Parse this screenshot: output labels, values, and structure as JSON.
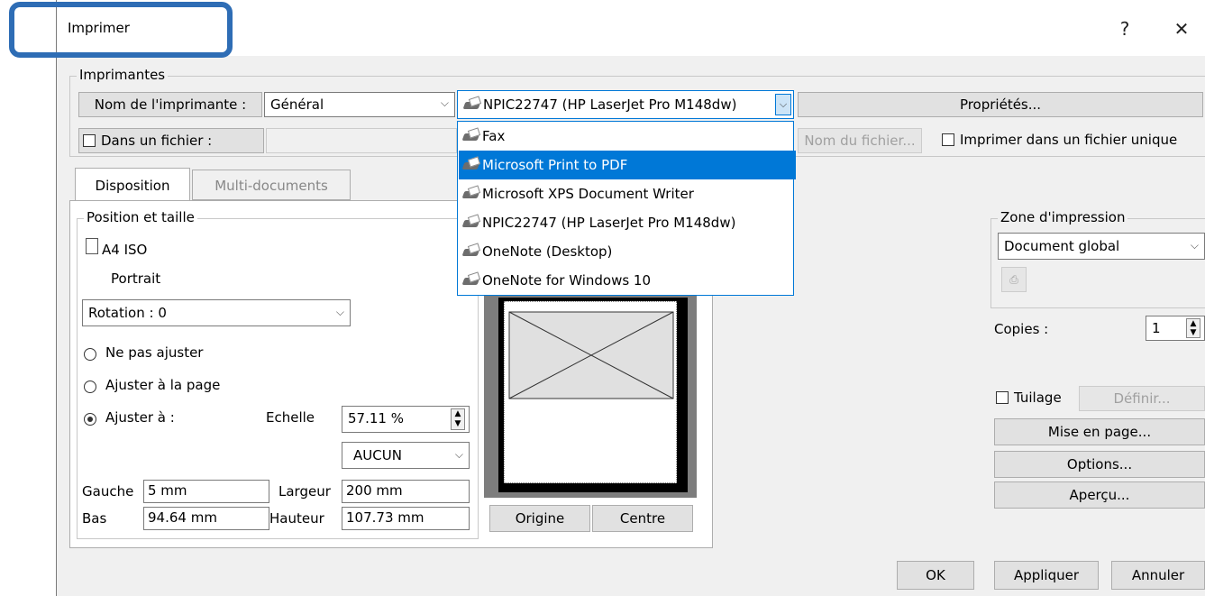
{
  "window": {
    "title": "Imprimer",
    "help": "?",
    "close": "✕"
  },
  "imprimantes": {
    "group_label": "Imprimantes",
    "printer_name_label": "Nom de l'imprimante :",
    "category": "Général",
    "selected_printer": "NPIC22747 (HP LaserJet Pro M148dw)",
    "properties_label": "Propriétés...",
    "to_file_label": "Dans un fichier :",
    "file_name_label": "Nom du fichier...",
    "single_file_label": "Imprimer dans un fichier unique",
    "dropdown": [
      {
        "label": "Fax",
        "selected": false
      },
      {
        "label": "Microsoft Print to PDF",
        "selected": true
      },
      {
        "label": "Microsoft XPS Document Writer",
        "selected": false
      },
      {
        "label": "NPIC22747 (HP LaserJet Pro M148dw)",
        "selected": false
      },
      {
        "label": "OneNote (Desktop)",
        "selected": false
      },
      {
        "label": "OneNote for Windows 10",
        "selected": false
      }
    ]
  },
  "tabs": [
    {
      "label": "Disposition",
      "active": true
    },
    {
      "label": "Multi-documents",
      "active": false
    }
  ],
  "position": {
    "group_label": "Position et taille",
    "paper": "A4 ISO",
    "orientation": "Portrait",
    "rotation": "Rotation : 0",
    "no_fit": "Ne pas ajuster",
    "fit_page": "Ajuster à la page",
    "fit_to": "Ajuster à :",
    "scale_label": "Echelle",
    "scale_value": "57.11 %",
    "scale_unit": "AUCUN",
    "left_label": "Gauche",
    "left_value": "5 mm",
    "width_label": "Largeur",
    "width_value": "200 mm",
    "bottom_label": "Bas",
    "bottom_value": "94.64 mm",
    "height_label": "Hauteur",
    "height_value": "107.73 mm"
  },
  "preview": {
    "origin_label": "Origine",
    "center_label": "Centre"
  },
  "zone": {
    "group_label": "Zone d'impression",
    "value": "Document global"
  },
  "copies": {
    "label": "Copies :",
    "value": "1"
  },
  "tiling": {
    "label": "Tuilage",
    "define_label": "Définir..."
  },
  "actions": {
    "page_setup": "Mise en page...",
    "options": "Options...",
    "preview": "Aperçu..."
  },
  "footer": {
    "ok": "OK",
    "apply": "Appliquer",
    "cancel": "Annuler"
  },
  "colors": {
    "accent": "#0078d7",
    "highlight_box": "#2e6db5"
  }
}
